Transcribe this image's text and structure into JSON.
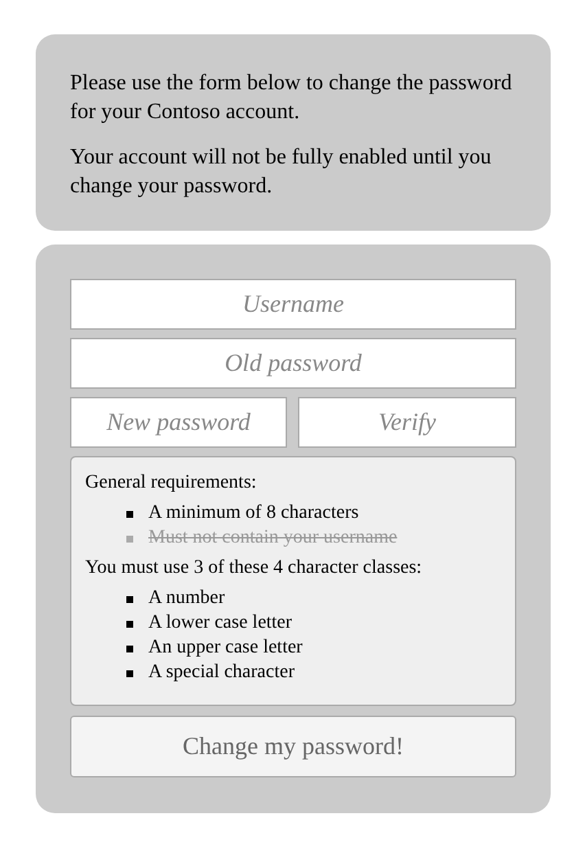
{
  "intro": {
    "paragraphs": [
      "Please use the form below to change the password for your Contoso account.",
      "Your account will not be fully enabled until you change your password."
    ]
  },
  "form": {
    "username": {
      "placeholder": "Username"
    },
    "old_password": {
      "placeholder": "Old password"
    },
    "new_password": {
      "placeholder": "New password"
    },
    "verify": {
      "placeholder": "Verify"
    },
    "requirements": [
      {
        "heading": "General requirements:",
        "items": [
          {
            "label": "A minimum of 8 characters",
            "met": false
          },
          {
            "label": "Must not contain your username",
            "met": true
          }
        ]
      },
      {
        "heading": "You must use 3 of these 4 character classes:",
        "items": [
          {
            "label": "A number",
            "met": false
          },
          {
            "label": "A lower case letter",
            "met": false
          },
          {
            "label": "An upper case letter",
            "met": false
          },
          {
            "label": "A special character",
            "met": false
          }
        ]
      }
    ],
    "submit": "Change my password!"
  }
}
